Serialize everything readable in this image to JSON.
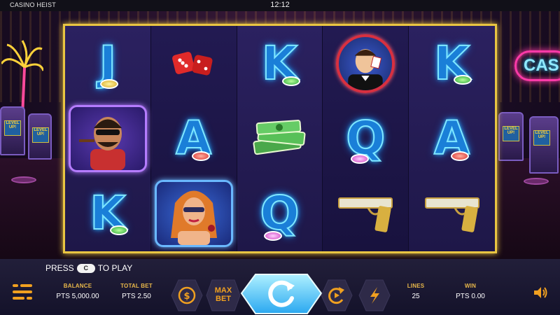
{
  "header": {
    "title": "CASINO HEIST",
    "clock": "12:12"
  },
  "background": {
    "neon_sign_text": "CAS",
    "slot_screen_text": "LEVEL UP!"
  },
  "reels": [
    [
      "letter-J",
      "character-cigar-man",
      "letter-K"
    ],
    [
      "dice",
      "letter-A",
      "character-redhead-woman"
    ],
    [
      "letter-K",
      "cash-stack",
      "letter-Q"
    ],
    [
      "character-card-dealer",
      "letter-Q",
      "golden-pistol"
    ],
    [
      "letter-K",
      "letter-A",
      "golden-pistol"
    ]
  ],
  "symbol_letters": {
    "J": "J",
    "K": "K",
    "A": "A",
    "Q": "Q"
  },
  "hint": {
    "press": "PRESS",
    "key": "C",
    "to_play": "TO PLAY"
  },
  "controls": {
    "balance_label": "BALANCE",
    "balance_value": "PTS 5,000.00",
    "total_bet_label": "TOTAL BET",
    "total_bet_value": "PTS 2.50",
    "max_bet_line1": "MAX",
    "max_bet_line2": "BET",
    "lines_label": "LINES",
    "lines_value": "25",
    "win_label": "WIN",
    "win_value": "PTS 0.00"
  },
  "icons": [
    "menu-icon",
    "coin-icon",
    "spin-icon",
    "autoplay-icon",
    "turbo-icon",
    "speaker-icon"
  ],
  "colors": {
    "accent": "#f0a020",
    "frame_gold": "#e9c542",
    "neon_blue": "#35c8ff",
    "label_gold": "#e8b84a"
  }
}
